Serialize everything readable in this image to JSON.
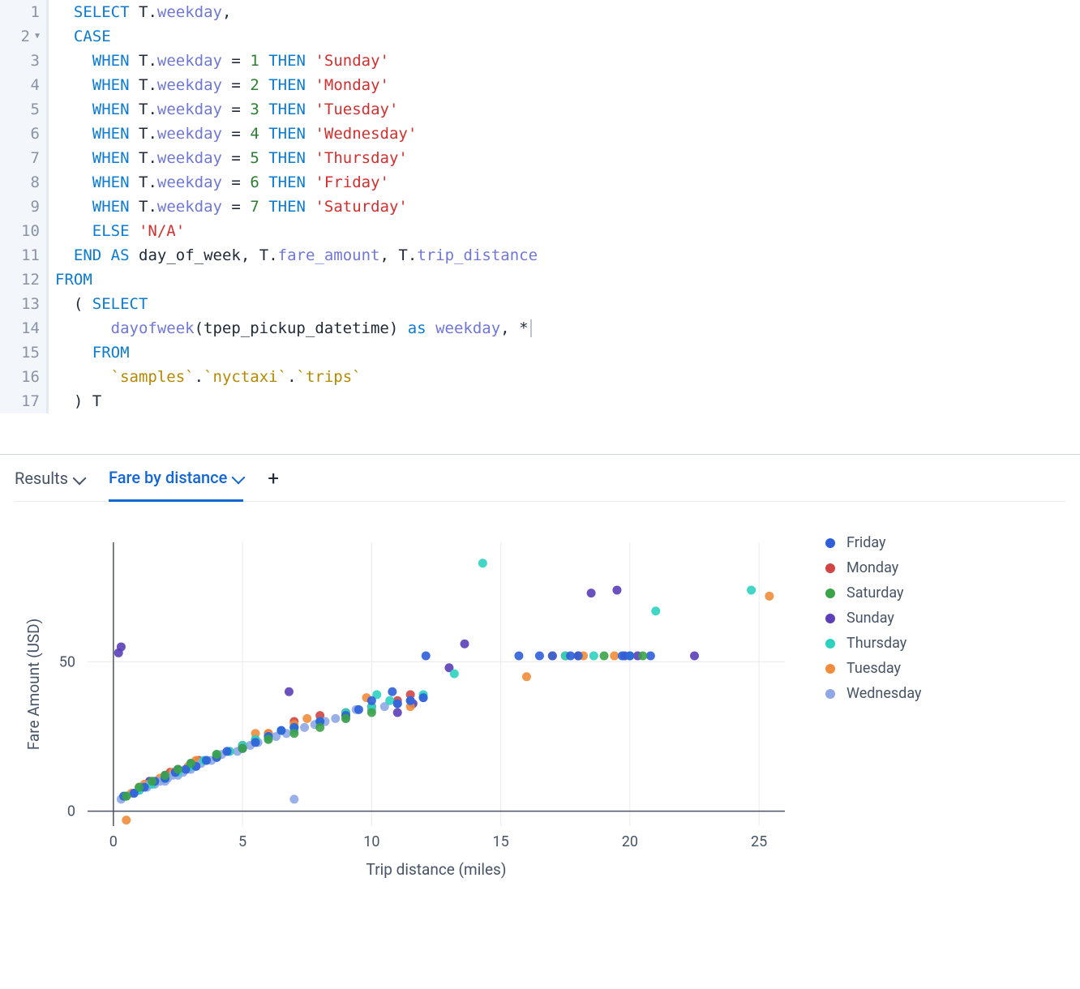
{
  "editor": {
    "line_count": 17,
    "foldable_lines": [
      2
    ],
    "tokens": {
      "select": "SELECT",
      "case": "CASE",
      "when": "WHEN",
      "then": "THEN",
      "else": "ELSE",
      "end": "END",
      "as": "AS",
      "as_lc": "as",
      "from": "FROM",
      "table_alias": "T",
      "weekday_prop": "weekday",
      "fare_prop": "fare_amount",
      "dist_prop": "trip_distance",
      "dow_col": "day_of_week",
      "dayofweek_fn": "dayofweek",
      "pickup_col": "tpep_pickup_datetime",
      "star": "*",
      "num1": "1",
      "num2": "2",
      "num3": "3",
      "num4": "4",
      "num5": "5",
      "num6": "6",
      "num7": "7",
      "sunday": "'Sunday'",
      "monday": "'Monday'",
      "tuesday": "'Tuesday'",
      "wednesday": "'Wednesday'",
      "thursday": "'Thursday'",
      "friday": "'Friday'",
      "saturday": "'Saturday'",
      "na": "'N/A'",
      "samples": "samples",
      "nyctaxi": "nyctaxi",
      "trips": "trips",
      "backtick": "`",
      "dot": ".",
      "comma": ",",
      "eq": "=",
      "open_paren": "(",
      "close_paren": ")"
    }
  },
  "tabs": {
    "results": "Results",
    "fare_by_distance": "Fare by distance"
  },
  "chart_data": {
    "type": "scatter",
    "xlabel": "Trip distance (miles)",
    "ylabel": "Fare Amount (USD)",
    "xlim": [
      -1,
      26
    ],
    "ylim": [
      -5,
      90
    ],
    "x_ticks": [
      0,
      5,
      10,
      15,
      20,
      25
    ],
    "y_ticks": [
      0,
      50
    ],
    "legend": [
      {
        "name": "Friday",
        "color": "#2e5fd9"
      },
      {
        "name": "Monday",
        "color": "#d24545"
      },
      {
        "name": "Saturday",
        "color": "#3ba348"
      },
      {
        "name": "Sunday",
        "color": "#5b3eb8"
      },
      {
        "name": "Thursday",
        "color": "#2ed1c0"
      },
      {
        "name": "Tuesday",
        "color": "#f08c3b"
      },
      {
        "name": "Wednesday",
        "color": "#8ea7e6"
      }
    ],
    "series": [
      {
        "name": "Sunday",
        "color": "#5b3eb8",
        "points": [
          [
            0.2,
            53
          ],
          [
            0.3,
            55
          ],
          [
            0.5,
            5
          ],
          [
            1,
            8
          ],
          [
            1.4,
            10
          ],
          [
            2,
            12
          ],
          [
            2.5,
            14
          ],
          [
            3,
            16
          ],
          [
            4,
            18
          ],
          [
            5,
            22
          ],
          [
            6,
            25
          ],
          [
            6.8,
            40
          ],
          [
            7,
            28
          ],
          [
            8,
            30
          ],
          [
            11,
            33
          ],
          [
            11.6,
            36
          ],
          [
            13,
            48
          ],
          [
            13.6,
            56
          ],
          [
            17.5,
            52
          ],
          [
            18.5,
            73
          ],
          [
            19.5,
            74
          ],
          [
            19.8,
            52
          ],
          [
            20.3,
            52
          ],
          [
            22.5,
            52
          ]
        ]
      },
      {
        "name": "Monday",
        "color": "#d24545",
        "points": [
          [
            0.5,
            5
          ],
          [
            1,
            7
          ],
          [
            1.4,
            9
          ],
          [
            2,
            11
          ],
          [
            2.2,
            13
          ],
          [
            3,
            15
          ],
          [
            3.3,
            17
          ],
          [
            4,
            19
          ],
          [
            5,
            22
          ],
          [
            5.5,
            24
          ],
          [
            6,
            26
          ],
          [
            7,
            30
          ],
          [
            8,
            32
          ],
          [
            9,
            33
          ],
          [
            10,
            35
          ],
          [
            11,
            37
          ],
          [
            11.5,
            39
          ],
          [
            17,
            52
          ],
          [
            18,
            52
          ]
        ]
      },
      {
        "name": "Tuesday",
        "color": "#f08c3b",
        "points": [
          [
            0.5,
            -3
          ],
          [
            0.7,
            6
          ],
          [
            1,
            8
          ],
          [
            1.2,
            9
          ],
          [
            1.8,
            11
          ],
          [
            2.3,
            13
          ],
          [
            2.9,
            15
          ],
          [
            3.2,
            17
          ],
          [
            4,
            19
          ],
          [
            4.5,
            20
          ],
          [
            5,
            22
          ],
          [
            5.5,
            26
          ],
          [
            6,
            26
          ],
          [
            7,
            29
          ],
          [
            7.5,
            31
          ],
          [
            8,
            30
          ],
          [
            9,
            32
          ],
          [
            9.8,
            38
          ],
          [
            11,
            36
          ],
          [
            11.5,
            35
          ],
          [
            16,
            45
          ],
          [
            17,
            52
          ],
          [
            17.5,
            52
          ],
          [
            18.2,
            52
          ],
          [
            19.4,
            52
          ],
          [
            25.4,
            72
          ]
        ]
      },
      {
        "name": "Wednesday",
        "color": "#8ea7e6",
        "points": [
          [
            0.3,
            4
          ],
          [
            0.5,
            5
          ],
          [
            0.8,
            6
          ],
          [
            1,
            7
          ],
          [
            1.1,
            8
          ],
          [
            1.3,
            8
          ],
          [
            1.4,
            9
          ],
          [
            1.6,
            9
          ],
          [
            1.8,
            10
          ],
          [
            2,
            10
          ],
          [
            2.1,
            11
          ],
          [
            2.3,
            12
          ],
          [
            2.5,
            12
          ],
          [
            2.7,
            13
          ],
          [
            2.9,
            14
          ],
          [
            3,
            14
          ],
          [
            3.2,
            15
          ],
          [
            3.4,
            16
          ],
          [
            3.6,
            17
          ],
          [
            3.8,
            17
          ],
          [
            4,
            18
          ],
          [
            4.2,
            19
          ],
          [
            4.5,
            20
          ],
          [
            4.8,
            20
          ],
          [
            5,
            21
          ],
          [
            5.3,
            22
          ],
          [
            5.6,
            23
          ],
          [
            6,
            24
          ],
          [
            6.3,
            25
          ],
          [
            6.7,
            26
          ],
          [
            7,
            4
          ],
          [
            7,
            27
          ],
          [
            7.4,
            28
          ],
          [
            7.8,
            29
          ],
          [
            8.2,
            30
          ],
          [
            8.6,
            31
          ],
          [
            9,
            31
          ],
          [
            9.4,
            34
          ],
          [
            10,
            34
          ],
          [
            10.5,
            35
          ],
          [
            11,
            36
          ],
          [
            11.5,
            37
          ],
          [
            12,
            38
          ]
        ]
      },
      {
        "name": "Thursday",
        "color": "#2ed1c0",
        "points": [
          [
            0.5,
            5
          ],
          [
            1,
            7
          ],
          [
            1.5,
            9
          ],
          [
            2,
            11
          ],
          [
            2.5,
            13
          ],
          [
            3,
            15
          ],
          [
            3.5,
            17
          ],
          [
            4,
            19
          ],
          [
            4.5,
            20
          ],
          [
            5,
            22
          ],
          [
            5.5,
            24
          ],
          [
            6,
            25
          ],
          [
            6.5,
            27
          ],
          [
            7,
            28
          ],
          [
            8,
            30
          ],
          [
            9,
            33
          ],
          [
            10,
            35
          ],
          [
            10.2,
            39
          ],
          [
            10.7,
            37
          ],
          [
            12,
            39
          ],
          [
            13.2,
            46
          ],
          [
            14.3,
            83
          ],
          [
            17.5,
            52
          ],
          [
            18.6,
            52
          ],
          [
            20,
            52
          ],
          [
            21,
            67
          ],
          [
            24.7,
            74
          ]
        ]
      },
      {
        "name": "Friday",
        "color": "#2e5fd9",
        "points": [
          [
            0.4,
            5
          ],
          [
            0.8,
            6
          ],
          [
            1.2,
            8
          ],
          [
            1.6,
            10
          ],
          [
            2,
            11
          ],
          [
            2.4,
            13
          ],
          [
            2.8,
            14
          ],
          [
            3.2,
            15
          ],
          [
            3.6,
            17
          ],
          [
            4,
            18
          ],
          [
            4.4,
            20
          ],
          [
            5,
            21
          ],
          [
            5.5,
            23
          ],
          [
            6,
            25
          ],
          [
            6.5,
            27
          ],
          [
            7,
            28
          ],
          [
            8,
            30
          ],
          [
            9,
            32
          ],
          [
            9.5,
            34
          ],
          [
            10,
            37
          ],
          [
            10.8,
            40
          ],
          [
            11,
            36
          ],
          [
            11.5,
            37
          ],
          [
            12,
            38
          ],
          [
            12.1,
            52
          ],
          [
            15.7,
            52
          ],
          [
            16.5,
            52
          ],
          [
            17,
            52
          ],
          [
            17.7,
            52
          ],
          [
            18,
            52
          ],
          [
            19.7,
            52
          ],
          [
            20,
            52
          ],
          [
            20.8,
            52
          ]
        ]
      },
      {
        "name": "Saturday",
        "color": "#3ba348",
        "points": [
          [
            0.5,
            5
          ],
          [
            1,
            8
          ],
          [
            1.5,
            10
          ],
          [
            2,
            12
          ],
          [
            2.5,
            14
          ],
          [
            3,
            16
          ],
          [
            4,
            19
          ],
          [
            5,
            21
          ],
          [
            6,
            24
          ],
          [
            7,
            26
          ],
          [
            8,
            28
          ],
          [
            9,
            31
          ],
          [
            10,
            33
          ],
          [
            19,
            52
          ],
          [
            20.5,
            52
          ]
        ]
      }
    ]
  }
}
